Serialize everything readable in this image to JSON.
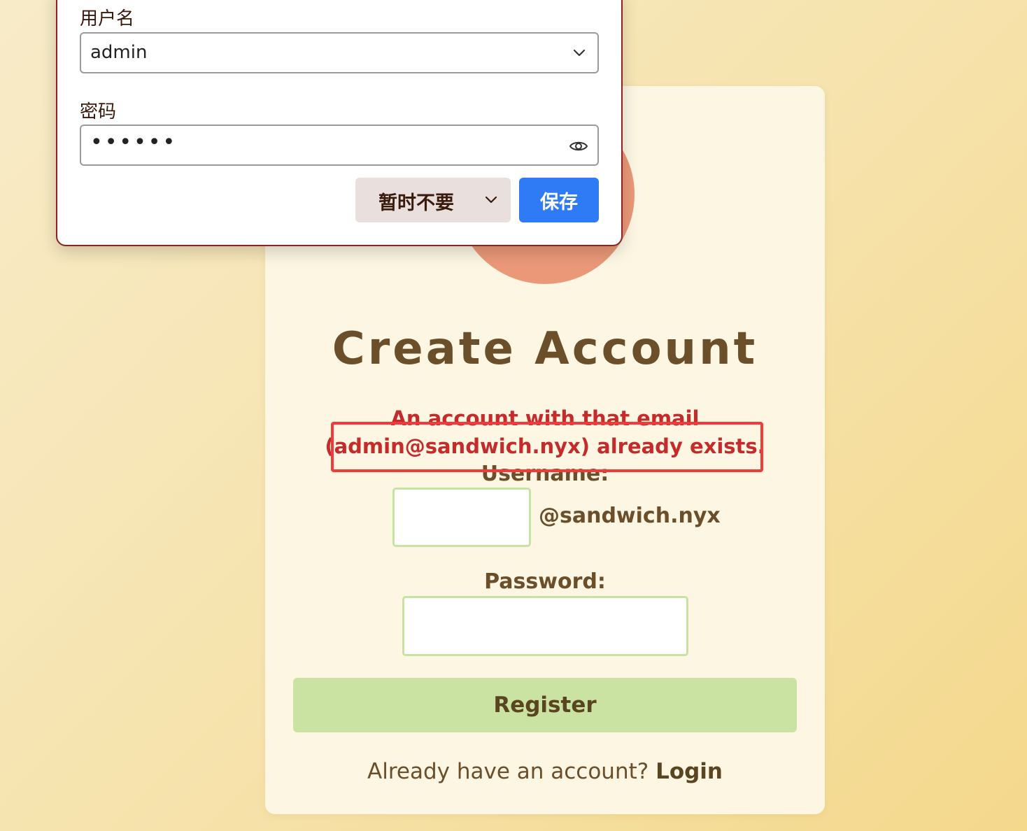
{
  "popup": {
    "username_label": "用户名",
    "username_value": "admin",
    "password_label": "密码",
    "password_mask": "••••••",
    "not_now_label": "暂时不要",
    "save_label": "保存"
  },
  "register": {
    "title": "Create Account",
    "error_line1": "An account with that email",
    "error_line2": "(admin@sandwich.nyx) already exists.",
    "username_label": "Username:",
    "domain_suffix": "@sandwich.nyx",
    "password_label": "Password:",
    "register_button": "Register",
    "login_prompt": "Already have an account?",
    "login_link": "Login"
  },
  "colors": {
    "accent_green": "#cbe3a2",
    "error_red": "#c62b2b",
    "highlight_red": "#f23a3a",
    "save_blue": "#2f7af5",
    "decor_circle": "#ea9878"
  },
  "icons": [
    "chevron-down-icon",
    "eye-icon"
  ]
}
